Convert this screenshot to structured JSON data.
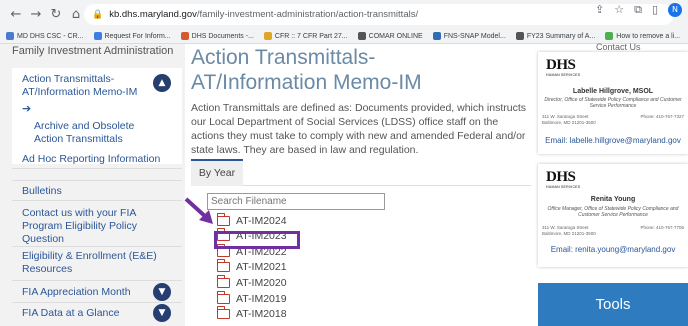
{
  "browser": {
    "url_host": "kb.dhs.maryland.gov",
    "url_path": "/family-investment-administration/action-transmittals/",
    "profile_initial": "N",
    "bookmarks": [
      {
        "label": "MD DHS CSC - CR...",
        "color": "#4a7bd0"
      },
      {
        "label": "Request For Inform...",
        "color": "#3d7ee6"
      },
      {
        "label": "DHS Documents -...",
        "color": "#d65a2f"
      },
      {
        "label": "CFR :: 7 CFR Part 27...",
        "color": "#e0a526"
      },
      {
        "label": "COMAR ONLINE",
        "color": "#555555"
      },
      {
        "label": "FNS-SNAP Model...",
        "color": "#2e6db4"
      },
      {
        "label": "FY23 Summary of A...",
        "color": "#555555"
      },
      {
        "label": "How to remove a li...",
        "color": "#4caf50"
      }
    ]
  },
  "sidebar": {
    "heading": "Family Investment Administration",
    "active_item": "Action Transmittals-AT/Information Memo-IM",
    "sub_item": "Archive and Obsolete Action Transmittals",
    "items": [
      "Ad Hoc Reporting Information",
      "Bulletins",
      "Contact us with your FIA Program Eligibility Policy Question",
      "Eligibility & Enrollment (E&E) Resources",
      "FIA Appreciation Month",
      "FIA Data at a Glance"
    ]
  },
  "main": {
    "title": "Action Transmittals-AT/Information Memo-IM",
    "intro": "Action Transmittals are defined as: Documents provided, which instructs our Local Department of Social Services (LDSS) office staff on the actions they must take to comply with new and amended Federal and/or state laws. They are based in law and regulation.",
    "tab_label": "By Year",
    "search_placeholder": "Search Filename",
    "folders": [
      "AT-IM2024",
      "AT-IM2023",
      "AT-IM2022",
      "AT-IM2021",
      "AT-IM2020",
      "AT-IM2019",
      "AT-IM2018"
    ],
    "highlighted_folder": "AT-IM2023",
    "annotation_color": "#7030a0"
  },
  "right_panel": {
    "contact_label": "Contact Us",
    "contacts": [
      {
        "logo": "DHS",
        "logo_sub": "HUMAN SERVICES",
        "name": "Labelle Hillgrove, MSOL",
        "title": "Director, Office of Statewide Policy Compliance and Customer Service Performance",
        "address1": "311 W. Saratoga Street",
        "address2": "Baltimore, MD 21201-3500",
        "phone": "Phone: 410-767-7327",
        "email": "Email: labelle.hillgrove@maryland.gov"
      },
      {
        "logo": "DHS",
        "logo_sub": "HUMAN SERVICES",
        "name": "Renita Young",
        "title": "Office Manager, Office of Statewide Policy Compliance and Customer Service Performance",
        "address1": "311 W. Saratoga Street",
        "address2": "Baltimore, MD 21201-3500",
        "phone": "Phone: 410-767-7706",
        "email": "Email: renita.young@maryland.gov"
      }
    ],
    "tools_label": "Tools"
  }
}
